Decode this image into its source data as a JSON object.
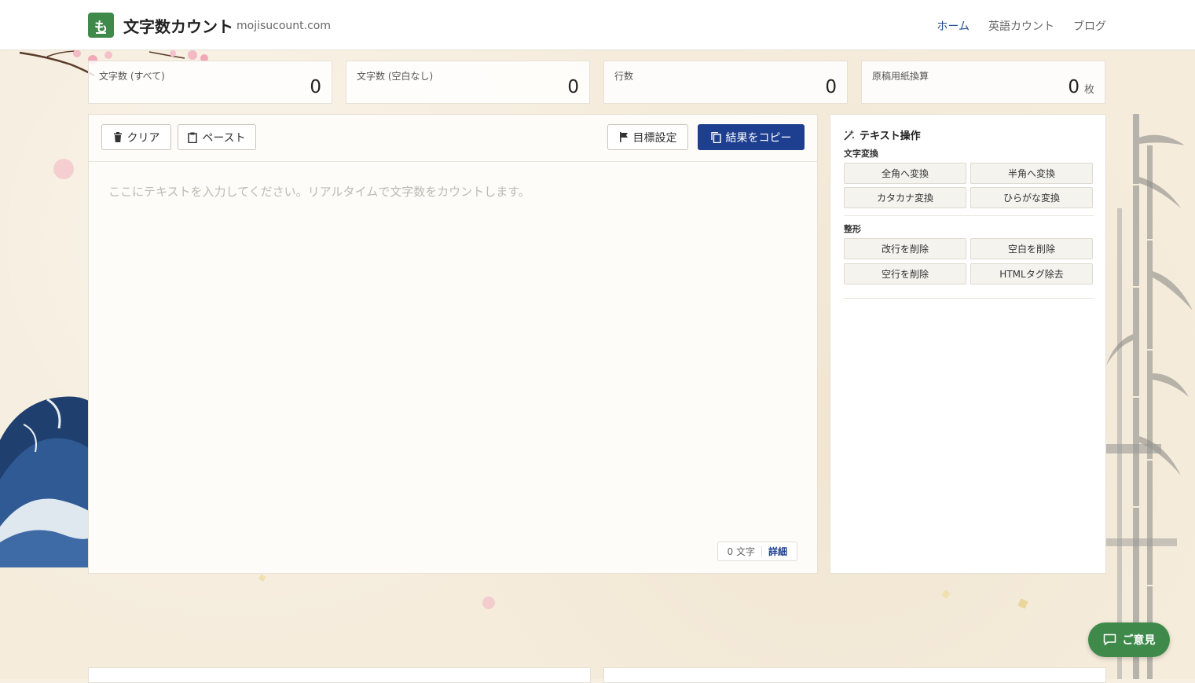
{
  "header": {
    "logo_char": "も",
    "title": "文字数カウント",
    "domain": "mojisucount.com",
    "nav": [
      {
        "label": "ホーム",
        "active": true
      },
      {
        "label": "英語カウント",
        "active": false
      },
      {
        "label": "ブログ",
        "active": false
      }
    ]
  },
  "stats": [
    {
      "label": "文字数 (すべて)",
      "value": "0",
      "unit": ""
    },
    {
      "label": "文字数 (空白なし)",
      "value": "0",
      "unit": ""
    },
    {
      "label": "行数",
      "value": "0",
      "unit": ""
    },
    {
      "label": "原稿用紙換算",
      "value": "0",
      "unit": "枚"
    }
  ],
  "editor": {
    "clear_label": "クリア",
    "paste_label": "ペースト",
    "goal_label": "目標設定",
    "copy_label": "結果をコピー",
    "placeholder": "ここにテキストを入力してください。リアルタイムで文字数をカウントします。",
    "counter_text": "0 文字",
    "detail_label": "詳細"
  },
  "side": {
    "title": "テキスト操作",
    "conversion_label": "文字変換",
    "conversion_buttons": [
      "全角へ変換",
      "半角へ変換",
      "カタカナ変換",
      "ひらがな変換"
    ],
    "format_label": "整形",
    "format_buttons": [
      "改行を削除",
      "空白を削除",
      "空行を削除",
      "HTMLタグ除去"
    ]
  },
  "feedback_label": "ご意見",
  "colors": {
    "brand_green": "#3f8a4a",
    "primary_blue": "#1e3f8f",
    "background_paper": "#f5ecdc"
  }
}
